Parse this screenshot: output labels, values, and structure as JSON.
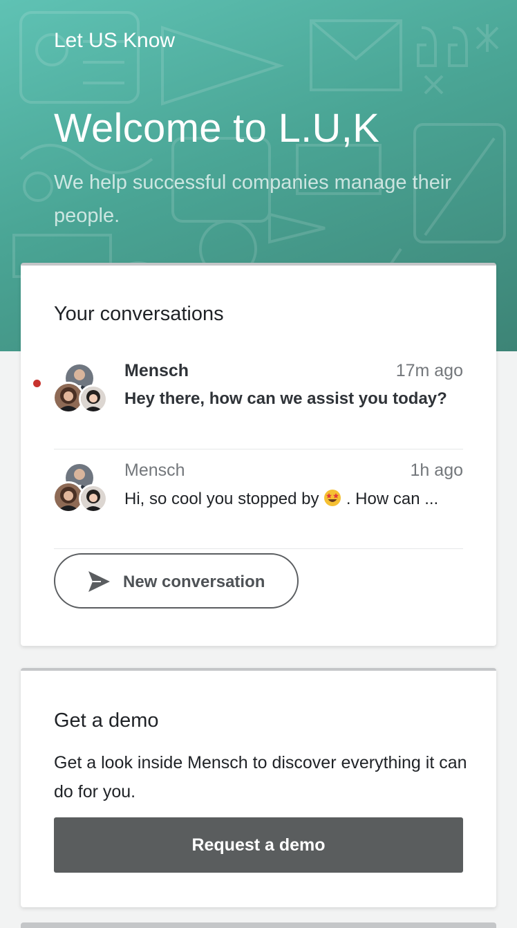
{
  "header": {
    "brand": "Let US Know",
    "title": "Welcome to L.U,K",
    "subtitle": "We help successful companies manage their people."
  },
  "conversations": {
    "title": "Your conversations",
    "items": [
      {
        "sender": "Mensch",
        "time": "17m ago",
        "message": "Hey there, how can we assist you today?",
        "unread": true
      },
      {
        "sender": "Mensch",
        "time": "1h ago",
        "message_before_emoji": "Hi, so cool you stopped by",
        "emoji": "star-struck-emoji",
        "message_after_emoji": ". How can ...",
        "unread": false
      }
    ],
    "new_button_label": "New conversation",
    "new_button_icon": "send-icon"
  },
  "demo": {
    "title": "Get a demo",
    "text": "Get a look inside Mensch to discover everything it can do for you.",
    "button_label": "Request a demo"
  },
  "colors": {
    "header_gradient_start": "#5fc2b4",
    "header_gradient_end": "#3d8476",
    "unread_dot": "#c7332e",
    "demo_button": "#5a5d5e"
  }
}
